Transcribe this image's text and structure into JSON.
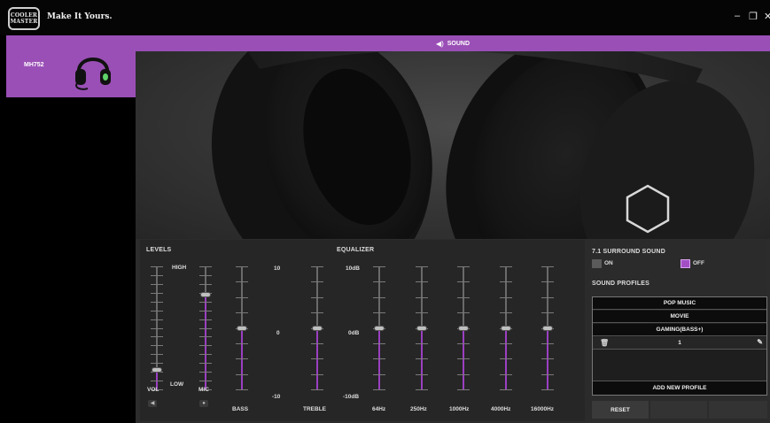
{
  "app": {
    "logo_lines": [
      "COOLER",
      "MASTER"
    ],
    "tagline": "Make It Yours.",
    "window_controls": {
      "minimize": "–",
      "maximize": "❐",
      "close": "✕"
    }
  },
  "sidebar": {
    "device": {
      "name": "MH752",
      "icon": "headset-icon"
    }
  },
  "tabbar": {
    "icon": "speaker-icon",
    "label": "SOUND"
  },
  "levels": {
    "title": "LEVELS",
    "high_label": "HIGH",
    "low_label": "LOW",
    "sliders": [
      {
        "id": "vol",
        "label": "VOL",
        "value": 0.15,
        "icon": "speaker-icon"
      },
      {
        "id": "mic",
        "label": "MIC",
        "value": 0.78,
        "icon": "mic-icon"
      }
    ]
  },
  "tone": {
    "scale": {
      "top": "10",
      "mid": "0",
      "bottom": "-10"
    },
    "sliders": [
      {
        "id": "bass",
        "label": "BASS",
        "value": 0.5
      },
      {
        "id": "treble",
        "label": "TREBLE",
        "value": 0.5
      }
    ]
  },
  "equalizer": {
    "title": "EQUALIZER",
    "scale": {
      "top": "10dB",
      "mid": "0dB",
      "bottom": "-10dB"
    },
    "bands": [
      {
        "label": "64Hz",
        "value": 0.5
      },
      {
        "label": "250Hz",
        "value": 0.5
      },
      {
        "label": "1000Hz",
        "value": 0.5
      },
      {
        "label": "4000Hz",
        "value": 0.5
      },
      {
        "label": "16000Hz",
        "value": 0.5
      }
    ]
  },
  "surround": {
    "title": "7.1 SURROUND SOUND",
    "on_label": "ON",
    "off_label": "OFF",
    "selected": "off"
  },
  "profiles": {
    "title": "SOUND PROFILES",
    "items": [
      "POP MUSIC",
      "MOVIE",
      "GAMING(BASS+)"
    ],
    "editing": {
      "value": "1",
      "delete_icon": "trash-icon",
      "edit_icon": "pencil-icon"
    },
    "add_label": "ADD NEW PROFILE",
    "buttons": {
      "reset": "RESET"
    }
  },
  "colors": {
    "accent": "#9a4fb6",
    "slider_fill": "#9b3fc2",
    "background": "#000000"
  }
}
